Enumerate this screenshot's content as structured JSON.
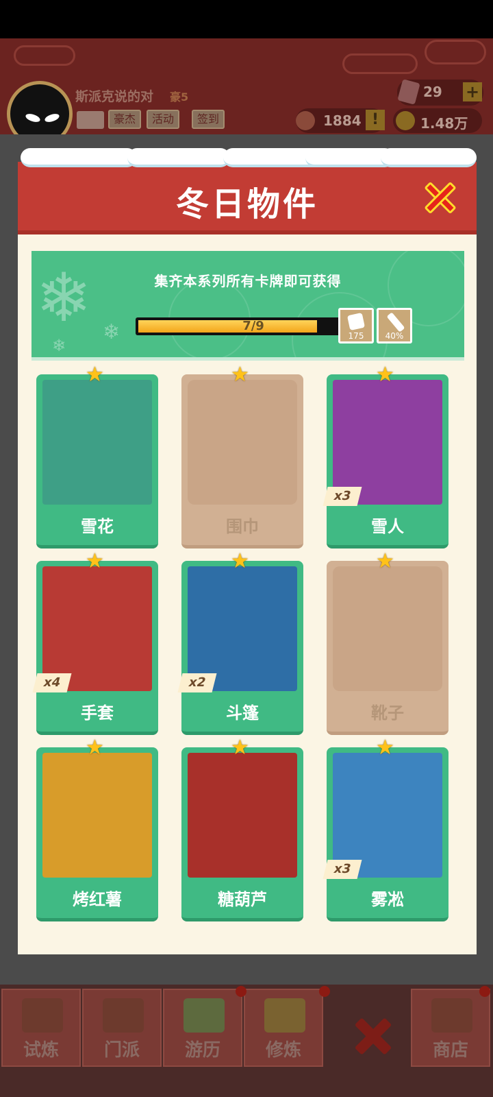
{
  "hud": {
    "player_name": "斯派克说的对",
    "rank": "豪5",
    "buttons": [
      "豪杰",
      "活动",
      "签到"
    ],
    "gems": "29",
    "plus": "+",
    "power": "1884",
    "warn": "!",
    "coins": "1.48万"
  },
  "panel": {
    "title": "冬日物件",
    "banner_text": "集齐本系列所有卡牌即可获得",
    "progress_text": "7/9",
    "progress_value": 0.778,
    "rewards": [
      {
        "icon": "dice-icon",
        "label": "175"
      },
      {
        "icon": "sword-icon",
        "label": "40%"
      }
    ]
  },
  "cards": [
    {
      "name": "雪花",
      "locked": false,
      "count": "",
      "theme": "#3e9f86"
    },
    {
      "name": "围巾",
      "locked": true,
      "count": "",
      "theme": ""
    },
    {
      "name": "雪人",
      "locked": false,
      "count": "x3",
      "theme": "#8e3fa0"
    },
    {
      "name": "手套",
      "locked": false,
      "count": "x4",
      "theme": "#b83a34"
    },
    {
      "name": "斗篷",
      "locked": false,
      "count": "x2",
      "theme": "#2e6ea6"
    },
    {
      "name": "靴子",
      "locked": true,
      "count": "",
      "theme": ""
    },
    {
      "name": "烤红薯",
      "locked": false,
      "count": "",
      "theme": "#d89c2a"
    },
    {
      "name": "糖葫芦",
      "locked": false,
      "count": "",
      "theme": "#a8302a"
    },
    {
      "name": "雾凇",
      "locked": false,
      "count": "x3",
      "theme": "#3d84bf"
    }
  ],
  "nav": [
    "试炼",
    "门派",
    "游历",
    "修炼",
    "",
    "商店"
  ],
  "colors": {
    "panel_red": "#c23c34",
    "card_green": "#40ba84",
    "star": "#ffc21a"
  }
}
